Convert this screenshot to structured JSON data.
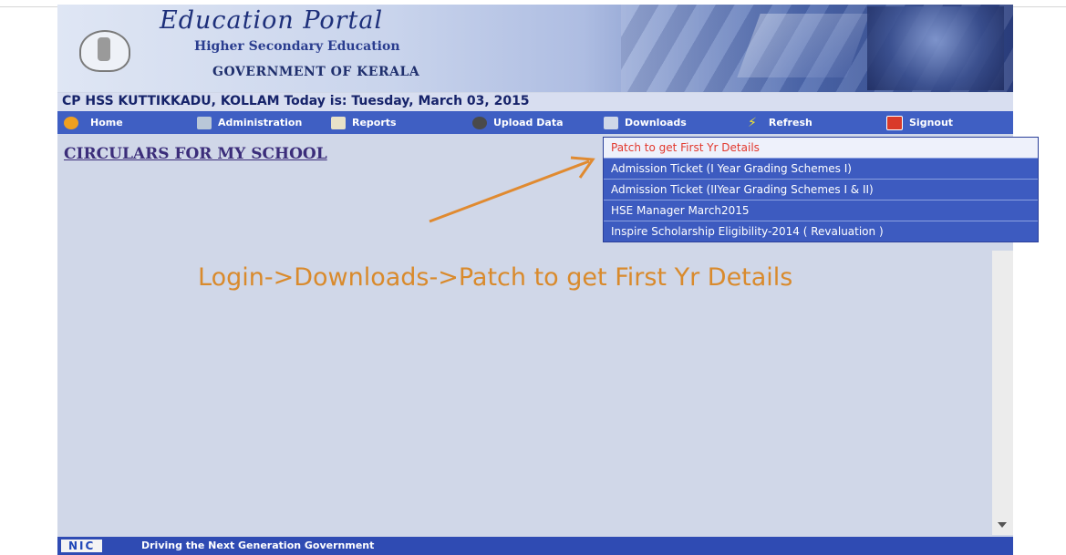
{
  "header": {
    "portal_title": "Education Portal",
    "subtitle": "Higher Secondary Education",
    "government": "GOVERNMENT OF KERALA"
  },
  "school_line": "CP HSS KUTTIKKADU, KOLLAM Today is: Tuesday, March 03, 2015",
  "nav": {
    "home": "Home",
    "administration": "Administration",
    "reports": "Reports",
    "upload": "Upload Data",
    "downloads": "Downloads",
    "refresh": "Refresh",
    "signout": "Signout"
  },
  "page_heading": "CIRCULARS FOR MY SCHOOL",
  "downloads_menu": [
    "Patch to get First Yr Details",
    "Admission Ticket (I Year Grading Schemes I)",
    "Admission Ticket (IIYear Grading Schemes I & II)",
    "HSE Manager March2015",
    "Inspire Scholarship Eligibility-2014 ( Revaluation )"
  ],
  "instruction": "Login->Downloads->Patch to get First Yr Details",
  "footer": {
    "logo": "NIC",
    "tagline": "Driving the Next Generation Government"
  },
  "colors": {
    "nav_bg": "#3f5fc3",
    "content_bg": "#d0d7e8",
    "instruction_text": "#d98a2c",
    "active_item_text": "#e2382d"
  },
  "icons": [
    "home-icon",
    "administration-icon",
    "reports-icon",
    "upload-icon",
    "downloads-icon",
    "refresh-icon",
    "signout-icon"
  ]
}
